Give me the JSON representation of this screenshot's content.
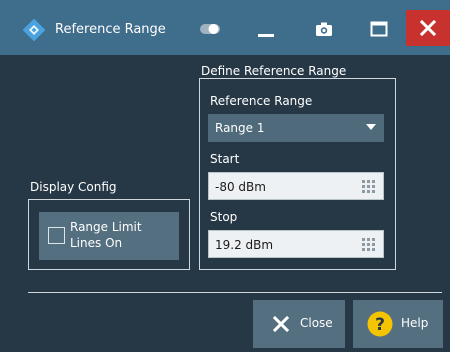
{
  "window": {
    "title": "Reference Range",
    "logo_icon": "rohde-schwarz-logo-icon",
    "toolbar_icons": [
      "toggle-icon",
      "minimize-icon",
      "camera-icon",
      "maximize-icon",
      "close-icon"
    ]
  },
  "display_config": {
    "heading": "Display Config",
    "range_limit_lines": {
      "label_line1": "Range Limit",
      "label_line2": "Lines On",
      "checked": false
    }
  },
  "define_reference_range": {
    "heading": "Define Reference Range",
    "reference_range_label": "Reference Range",
    "reference_range_value": "Range 1",
    "start_label": "Start",
    "start_value": "-80 dBm",
    "stop_label": "Stop",
    "stop_value": "19.2 dBm"
  },
  "buttons": {
    "close_label": "Close",
    "help_label": "Help"
  },
  "colors": {
    "background": "#263846",
    "titlebar": "#3f6d8c",
    "close_accent": "#c7322f",
    "button": "#546f7f",
    "help_icon": "#f5c400"
  }
}
